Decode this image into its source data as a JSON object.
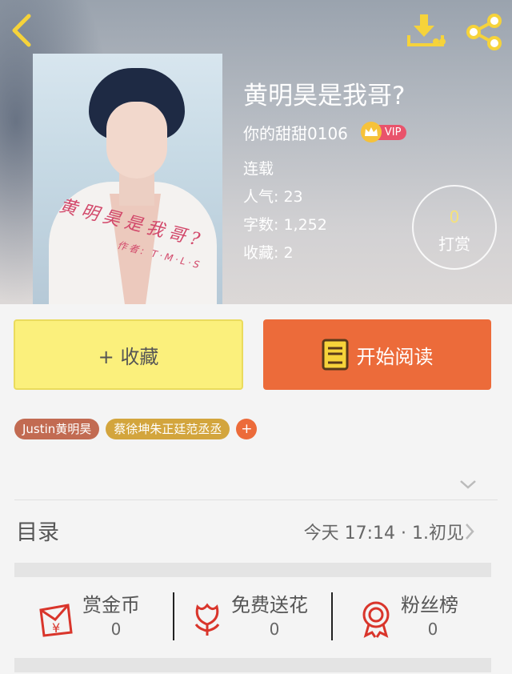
{
  "header": {
    "title": "黄明昊是我哥?",
    "author": "你的甜甜0106",
    "vip_label": "VIP",
    "status": "连载",
    "popularity_label": "人气:",
    "popularity": "23",
    "word_count_label": "字数:",
    "word_count": "1,252",
    "favorites_label": "收藏:",
    "favorites": "2",
    "tip_count": "0",
    "tip_label": "打赏",
    "icons": [
      "back-arrow-icon",
      "download-icon",
      "share-icon"
    ]
  },
  "cover": {
    "title_art": "黄明昊是我哥?",
    "author_art": "作者: T·M·L·S"
  },
  "actions": {
    "collect_label": "+ 收藏",
    "read_label": "开始阅读"
  },
  "tags": {
    "items": [
      "Justin黄明昊",
      "蔡徐坤朱正廷范丞丞"
    ],
    "add_label": "+"
  },
  "catalog": {
    "title": "目录",
    "latest": "今天 17:14 · 1.初见"
  },
  "stats": {
    "coins_label": "赏金币",
    "coins_value": "0",
    "flowers_label": "免费送花",
    "flowers_value": "0",
    "fans_label": "粉丝榜",
    "fans_value": "0"
  },
  "colors": {
    "accent_orange": "#ec6b3a",
    "collect_yellow": "#fbf07c",
    "icon_yellow": "#f6d33a",
    "icon_red": "#d9352b",
    "tag_brown": "#c26b52",
    "tag_gold": "#d3a53d",
    "vip_red": "#e9536b"
  }
}
